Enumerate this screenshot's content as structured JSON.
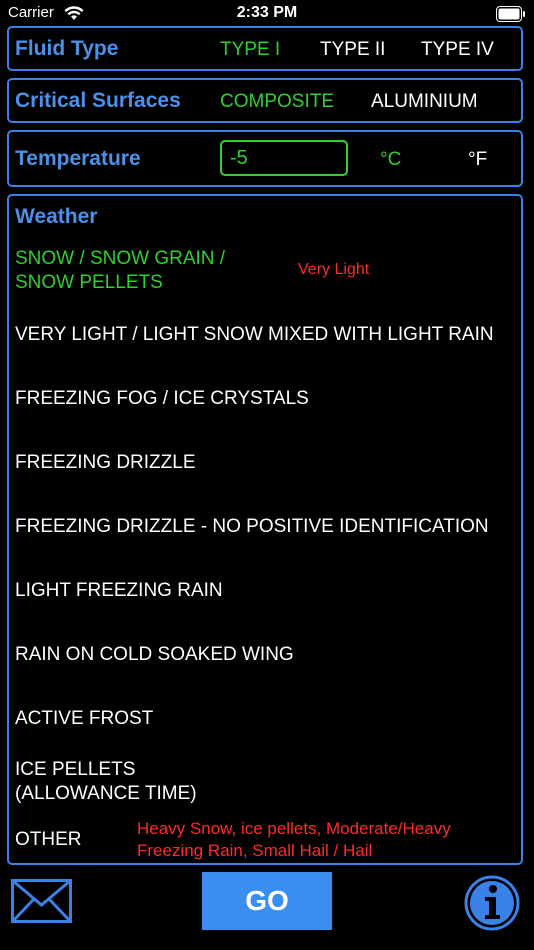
{
  "status_bar": {
    "carrier": "Carrier",
    "time": "2:33 PM"
  },
  "fluid_type": {
    "label": "Fluid Type",
    "options": [
      "TYPE I",
      "TYPE II",
      "TYPE IV"
    ],
    "selected": "TYPE I"
  },
  "critical_surfaces": {
    "label": "Critical Surfaces",
    "options": [
      "COMPOSITE",
      "ALUMINIUM"
    ],
    "selected": "COMPOSITE"
  },
  "temperature": {
    "label": "Temperature",
    "value": "-5",
    "units": [
      "°C",
      "°F"
    ],
    "selected_unit": "°C"
  },
  "weather": {
    "label": "Weather",
    "items": [
      {
        "line1": "SNOW / SNOW GRAIN /",
        "line2": "SNOW PELLETS",
        "selected": true,
        "intensity": "Very Light"
      },
      {
        "line1": "VERY LIGHT / LIGHT SNOW MIXED WITH LIGHT RAIN",
        "line2": ""
      },
      {
        "line1": "FREEZING FOG / ICE CRYSTALS",
        "line2": ""
      },
      {
        "line1": "FREEZING DRIZZLE",
        "line2": ""
      },
      {
        "line1": "FREEZING DRIZZLE - NO POSITIVE IDENTIFICATION",
        "line2": ""
      },
      {
        "line1": "LIGHT FREEZING RAIN",
        "line2": ""
      },
      {
        "line1": "RAIN ON COLD SOAKED WING",
        "line2": ""
      },
      {
        "line1": "ACTIVE FROST",
        "line2": ""
      },
      {
        "line1": "ICE PELLETS",
        "line2": "(ALLOWANCE TIME)"
      },
      {
        "line1": "OTHER",
        "line2": "",
        "note_line1": "Heavy Snow, ice pellets, Moderate/Heavy",
        "note_line2": "Freezing Rain, Small Hail / Hail"
      }
    ]
  },
  "footer": {
    "go_label": "GO",
    "mail_icon": "mail-icon",
    "info_icon": "info-icon"
  },
  "colors": {
    "accent_blue": "#3b82e8",
    "selected_green": "#2ed12e",
    "warning_red": "#ff2a2a",
    "background": "#000000"
  }
}
